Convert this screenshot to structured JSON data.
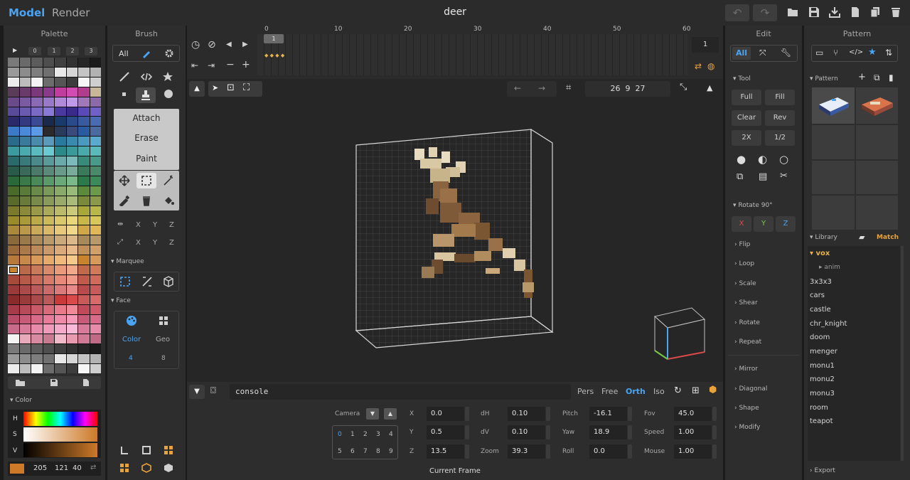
{
  "header": {
    "mode_model": "Model",
    "mode_render": "Render",
    "title": "deer",
    "undo_icon": "↶",
    "redo_icon": "↷",
    "actions": [
      "folder-open-icon",
      "save-icon",
      "export-icon",
      "new-file-icon",
      "copy-icon",
      "trash-icon"
    ]
  },
  "palette": {
    "title": "Palette",
    "play": "▶",
    "indices": [
      "0",
      "1",
      "2",
      "3"
    ],
    "selected_color": "#c8832d",
    "swatches": [
      "#7a7a7a",
      "#6a6a6a",
      "#5c5c5c",
      "#4e4e4e",
      "#404040",
      "#323232",
      "#262626",
      "#1a1a1a",
      "#9a9a9a",
      "#8c8c8c",
      "#7e7e7e",
      "#707070",
      "#e8e8e8",
      "#d6d6d6",
      "#c4c4c4",
      "#b2b2b2",
      "#ececec",
      "#bdbdbd",
      "#f4f4f4",
      "#6c6c6c",
      "#555555",
      "#3d3d3d",
      "#f6f6f6",
      "#cfcfcf",
      "#5a3c5a",
      "#6a3a6a",
      "#7a3a7a",
      "#8a3a8a",
      "#c23ca0",
      "#d04cb2",
      "#b03c8c",
      "#c8b898",
      "#6a4a8a",
      "#7a5aa0",
      "#8a6ab4",
      "#9a7ac8",
      "#b08ad8",
      "#c09ae6",
      "#a07ab8",
      "#8c6aa8",
      "#5a4a9a",
      "#6a5ab0",
      "#7a6ac6",
      "#8a7ad8",
      "#4a3aa0",
      "#3a2a8a",
      "#5a4ab8",
      "#7060c8",
      "#2a2a6a",
      "#333a80",
      "#3c4a96",
      "#1a2a4a",
      "#1a3a6a",
      "#2a4a8a",
      "#3a5aa0",
      "#4a6ab4",
      "#3a7ac8",
      "#4a8ad8",
      "#5a9ae6",
      "#2a2a2a",
      "#2a3a5a",
      "#3a4a7a",
      "#2a5aa0",
      "#4a6aa0",
      "#2a6a8a",
      "#3a7a9a",
      "#4a8aaa",
      "#5a9aba",
      "#2a7aa0",
      "#3a8ab0",
      "#4a9ac0",
      "#5aaad0",
      "#3a9aa0",
      "#4aaab0",
      "#5abac0",
      "#6acad0",
      "#2a8a8a",
      "#3a9a9a",
      "#4aaaaa",
      "#5ababa",
      "#2a6a6a",
      "#3a7a7a",
      "#4a8a8a",
      "#5a9a9a",
      "#6aaaaa",
      "#7ababa",
      "#3a8a7a",
      "#4a9a8a",
      "#2a5a4a",
      "#3a6a5a",
      "#4a7a6a",
      "#5a8a7a",
      "#6a9a8a",
      "#7aaa9a",
      "#3a7a5a",
      "#4a8a6a",
      "#2a6a3a",
      "#3a7a4a",
      "#4a8a5a",
      "#5a9a6a",
      "#6aaa7a",
      "#7aba8a",
      "#2a7a4a",
      "#3a8a5a",
      "#4a6a2a",
      "#5a7a3a",
      "#6a8a4a",
      "#7a9a5a",
      "#8aaa6a",
      "#9aba7a",
      "#5a8a3a",
      "#6a9a4a",
      "#5a6a2a",
      "#6a7a3a",
      "#7a8a4a",
      "#8a9a5a",
      "#9aaa6a",
      "#aaba7a",
      "#7a8a3a",
      "#8a9a4a",
      "#7a7a2a",
      "#8a8a3a",
      "#9a9a4a",
      "#aaaa5a",
      "#baba6a",
      "#caca7a",
      "#a8a83a",
      "#b8b84a",
      "#9a8a2a",
      "#aa9a3a",
      "#baaa4a",
      "#caba5a",
      "#dac86a",
      "#e8d87a",
      "#c8b84a",
      "#d8c85a",
      "#aa8a3a",
      "#ba9a4a",
      "#caaa5a",
      "#dab86a",
      "#e8c87a",
      "#f0d88a",
      "#d0a848",
      "#e0b858",
      "#8a6a3a",
      "#9a7a4a",
      "#aa8a5a",
      "#ba9a6a",
      "#caaa7a",
      "#dab88a",
      "#a88a5a",
      "#b89a6a",
      "#9a6a3a",
      "#aa7a4a",
      "#ba8a5a",
      "#ca9a6a",
      "#daaa7a",
      "#e8ba8a",
      "#c0905a",
      "#d0a06a",
      "#b87a3a",
      "#c88a4a",
      "#d89a5a",
      "#e8aa6a",
      "#f0ba7a",
      "#f4ca8a",
      "#c8832d",
      "#d89a5a",
      "#a85a3a",
      "#b86a4a",
      "#c87a5a",
      "#d88a6a",
      "#e89a7a",
      "#f0aa8a",
      "#c06a4a",
      "#d07a5a",
      "#a84a3a",
      "#b85a4a",
      "#c86a5a",
      "#d87a6a",
      "#e88a7a",
      "#f09a8a",
      "#c05a4a",
      "#d06a5a",
      "#9a3a3a",
      "#aa4a4a",
      "#ba5a5a",
      "#ca6a6a",
      "#da7a7a",
      "#e88a8a",
      "#b84a4a",
      "#c85a5a",
      "#8a2a2a",
      "#9a3a3a",
      "#aa4a4a",
      "#ba5a5a",
      "#ca3a3a",
      "#da4a4a",
      "#c85a5a",
      "#d86a6a",
      "#a83a4a",
      "#b84a5a",
      "#c85a6a",
      "#d86a7a",
      "#e87a8a",
      "#f08a9a",
      "#c04a5a",
      "#d05a6a",
      "#b84a6a",
      "#c85a7a",
      "#d86a8a",
      "#e87a9a",
      "#f08aaa",
      "#f49aba",
      "#c85a7a",
      "#d86a8a",
      "#c86a8a",
      "#d87a9a",
      "#e88aaa",
      "#f09aba",
      "#f4aaca",
      "#f8bad8",
      "#d87a9a",
      "#e88aaa",
      "#f4f4f4",
      "#e8aaba",
      "#d88aa0",
      "#c87a90",
      "#f0bacb",
      "#e89ab0",
      "#d07a96",
      "#c06a86"
    ],
    "actions": [
      "folder-open-icon",
      "save-icon",
      "file-icon"
    ]
  },
  "color": {
    "section": "Color",
    "h": "H",
    "s": "S",
    "v": "V",
    "r": "205",
    "g": "121",
    "b": "40",
    "value": "#cd7928"
  },
  "brush": {
    "title": "Brush",
    "all": "All",
    "modes": [
      "Attach",
      "Erase",
      "Paint"
    ],
    "axes_row1": [
      "X",
      "Y",
      "Z"
    ],
    "axes_row2": [
      "X",
      "Y",
      "Z"
    ],
    "marquee": "Marquee",
    "face": "Face",
    "face_color": "Color",
    "face_geo": "Geo",
    "face_color_num": "4",
    "face_geo_num": "8"
  },
  "timeline": {
    "ticks": [
      "0",
      "10",
      "20",
      "30",
      "40",
      "50",
      "60"
    ],
    "current_frame_marker": "1",
    "frame_field": "1"
  },
  "viewport": {
    "size_readout": "26  9  27",
    "console": "console",
    "views": [
      "Pers",
      "Free",
      "Orth",
      "Iso"
    ],
    "active_view": "Orth"
  },
  "camera": {
    "label": "Camera",
    "slots_row1": [
      "0",
      "1",
      "2",
      "3",
      "4"
    ],
    "slots_row2": [
      "5",
      "6",
      "7",
      "8",
      "9"
    ],
    "x_label": "X",
    "x": "0.0",
    "y_label": "Y",
    "y": "0.5",
    "z_label": "Z",
    "z": "13.5",
    "dh_label": "dH",
    "dh": "0.10",
    "dv_label": "dV",
    "dv": "0.10",
    "zoom_label": "Zoom",
    "zoom": "39.3",
    "pitch_label": "Pitch",
    "pitch": "-16.1",
    "yaw_label": "Yaw",
    "yaw": "18.9",
    "roll_label": "Roll",
    "roll": "0.0",
    "fov_label": "Fov",
    "fov": "45.0",
    "speed_label": "Speed",
    "speed": "1.00",
    "mouse_label": "Mouse",
    "mouse": "1.00",
    "footer": "Current Frame"
  },
  "edit": {
    "title": "Edit",
    "all": "All",
    "tool": "Tool",
    "buttons": [
      "Full",
      "Fill",
      "Clear",
      "Rev",
      "2X",
      "1/2"
    ],
    "rotate": "Rotate 90°",
    "axes": [
      "X",
      "Y",
      "Z"
    ],
    "sections_a": [
      "Flip",
      "Loop",
      "Scale",
      "Shear",
      "Rotate",
      "Repeat"
    ],
    "sections_b": [
      "Mirror",
      "Diagonal",
      "Shape",
      "Modify"
    ]
  },
  "pattern": {
    "title": "Pattern",
    "section": "Pattern",
    "library": "Library",
    "match": "Match",
    "tree": [
      "vox",
      "anim",
      "3x3x3",
      "cars",
      "castle",
      "chr_knight",
      "doom",
      "menger",
      "monu1",
      "monu2",
      "monu3",
      "room",
      "teapot"
    ],
    "export": "Export"
  }
}
